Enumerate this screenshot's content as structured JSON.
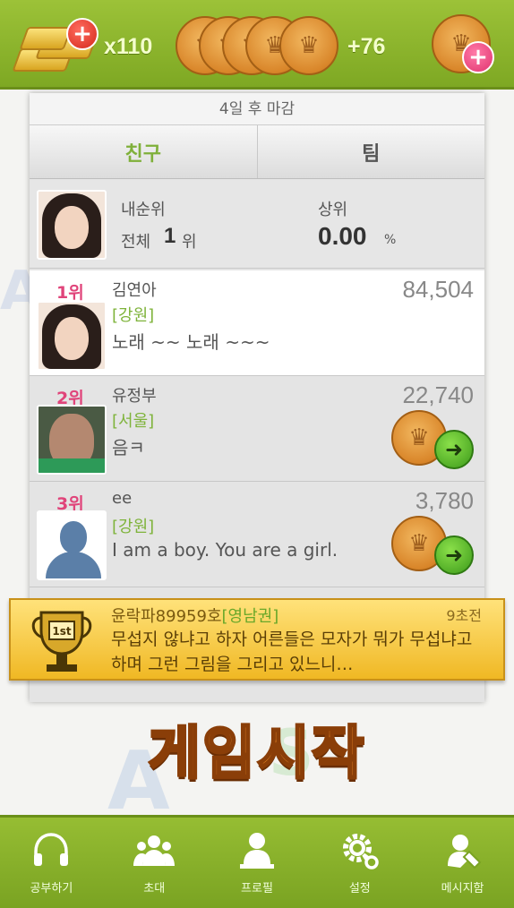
{
  "topbar": {
    "gold_count": "x110",
    "coin_count": "+76"
  },
  "panel": {
    "deadline": "4일 후 마감",
    "tabs": [
      {
        "label": "친구",
        "active": true
      },
      {
        "label": "팀",
        "active": false
      }
    ],
    "my_rank": {
      "label": "내순위",
      "total_prefix": "전체",
      "rank_value": "1",
      "rank_suffix": "위",
      "top_label": "상위",
      "top_percent": "0.00",
      "percent_sign": "%"
    },
    "rows": [
      {
        "rank": "1위",
        "name": "김연아",
        "region": "[강원]",
        "message": "노래 ~~ 노래 ~~~",
        "score": "84,504",
        "avatar": "girl",
        "send": false
      },
      {
        "rank": "2위",
        "name": "유정부",
        "region": "[서울]",
        "message": "음ㅋ",
        "score": "22,740",
        "avatar": "guy",
        "send": true
      },
      {
        "rank": "3위",
        "name": "ee",
        "region": "[강원]",
        "message": "I am a boy. You are a girl.",
        "score": "3,780",
        "avatar": "default",
        "send": true
      }
    ]
  },
  "banner": {
    "name": "윤락파89959호",
    "region": "[영남권]",
    "time": "9초전",
    "text": "무섭지 않냐고 하자 어른들은 모자가 뭐가 무섭냐고 하며 그런 그림을 그리고 있느니…"
  },
  "start_button": "게임시작",
  "bottom_nav": [
    {
      "label": "공부하기",
      "icon": "headphones-icon"
    },
    {
      "label": "초대",
      "icon": "people-icon"
    },
    {
      "label": "프로필",
      "icon": "profile-icon"
    },
    {
      "label": "설정",
      "icon": "gear-icon"
    },
    {
      "label": "메시지함",
      "icon": "message-icon"
    }
  ],
  "colors": {
    "green": "#8bb52d",
    "accent_pink": "#e0447a",
    "region_green": "#7eb33a",
    "banner_gold": "#f0b824"
  }
}
